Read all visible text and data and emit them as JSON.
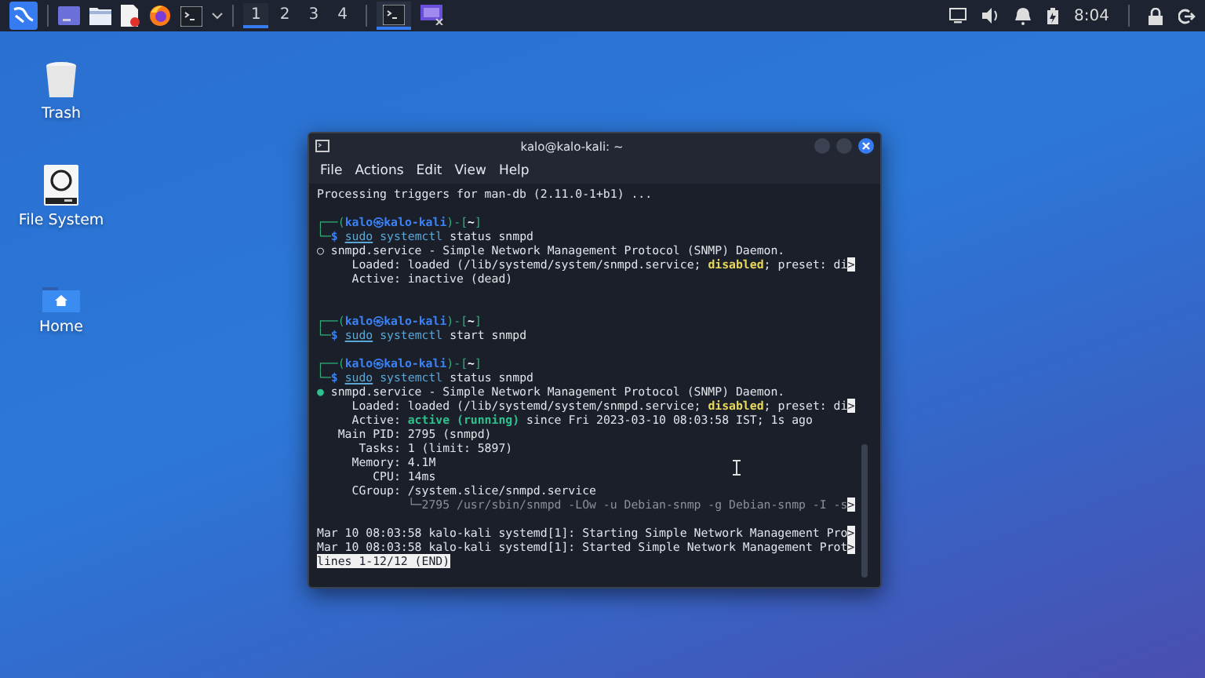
{
  "panel": {
    "launchers": [
      {
        "kind": "desktop"
      },
      {
        "kind": "files"
      },
      {
        "kind": "editor"
      },
      {
        "kind": "browser"
      },
      {
        "kind": "terminal"
      }
    ],
    "workspaces": [
      {
        "label": "1",
        "selected": true
      },
      {
        "label": "2",
        "selected": false
      },
      {
        "label": "3",
        "selected": false
      },
      {
        "label": "4",
        "selected": false
      }
    ],
    "tasks": [
      {
        "kind": "terminal",
        "selected": true
      },
      {
        "kind": "monitor",
        "selected": false
      }
    ],
    "clock": "8:04"
  },
  "desktop": {
    "icons": [
      {
        "label": "Trash",
        "kind": "trash"
      },
      {
        "label": "File System",
        "kind": "drive"
      },
      {
        "label": "Home",
        "kind": "home"
      }
    ]
  },
  "terminal": {
    "title": "kalo@kalo-kali: ~",
    "menu": [
      "File",
      "Actions",
      "Edit",
      "View",
      "Help"
    ],
    "lines": [
      {
        "kind": "text",
        "segs": [
          {
            "kind": "plain",
            "t": "Processing triggers for man-db (2.11.0-1+b1) ..."
          }
        ]
      },
      {
        "kind": "blank"
      },
      {
        "kind": "text",
        "segs": [
          {
            "kind": "frame",
            "t": "┌──("
          },
          {
            "kind": "user",
            "t": "kalo㉿kalo-kali"
          },
          {
            "kind": "frame",
            "t": ")-["
          },
          {
            "kind": "home",
            "t": "~"
          },
          {
            "kind": "frame",
            "t": "]"
          }
        ]
      },
      {
        "kind": "text",
        "segs": [
          {
            "kind": "frame",
            "t": "└─"
          },
          {
            "kind": "dollar",
            "t": "$ "
          },
          {
            "kind": "sudo",
            "t": "sudo"
          },
          {
            "kind": "command",
            "t": " systemctl"
          },
          {
            "kind": "plain",
            "t": " status snmpd"
          }
        ]
      },
      {
        "kind": "text",
        "segs": [
          {
            "kind": "plain",
            "t": "○ snmpd.service - Simple Network Management Protocol (SNMP) Daemon."
          }
        ]
      },
      {
        "kind": "text",
        "segs": [
          {
            "kind": "plain",
            "t": "     Loaded: loaded (/lib/systemd/system/snmpd.service; "
          },
          {
            "kind": "warning",
            "t": "disabled"
          },
          {
            "kind": "plain",
            "t": "; preset: di"
          },
          {
            "kind": "truncated",
            "t": ">"
          }
        ]
      },
      {
        "kind": "text",
        "segs": [
          {
            "kind": "plain",
            "t": "     Active: inactive (dead)"
          }
        ]
      },
      {
        "kind": "blank"
      },
      {
        "kind": "blank"
      },
      {
        "kind": "text",
        "segs": [
          {
            "kind": "frame",
            "t": "┌──("
          },
          {
            "kind": "user",
            "t": "kalo㉿kalo-kali"
          },
          {
            "kind": "frame",
            "t": ")-["
          },
          {
            "kind": "home",
            "t": "~"
          },
          {
            "kind": "frame",
            "t": "]"
          }
        ]
      },
      {
        "kind": "text",
        "segs": [
          {
            "kind": "frame",
            "t": "└─"
          },
          {
            "kind": "dollar",
            "t": "$ "
          },
          {
            "kind": "sudo",
            "t": "sudo"
          },
          {
            "kind": "command",
            "t": " systemctl"
          },
          {
            "kind": "plain",
            "t": " start snmpd"
          }
        ]
      },
      {
        "kind": "blank"
      },
      {
        "kind": "text",
        "segs": [
          {
            "kind": "frame",
            "t": "┌──("
          },
          {
            "kind": "user",
            "t": "kalo㉿kalo-kali"
          },
          {
            "kind": "frame",
            "t": ")-["
          },
          {
            "kind": "home",
            "t": "~"
          },
          {
            "kind": "frame",
            "t": "]"
          }
        ]
      },
      {
        "kind": "text",
        "segs": [
          {
            "kind": "frame",
            "t": "└─"
          },
          {
            "kind": "dollar",
            "t": "$ "
          },
          {
            "kind": "sudo",
            "t": "sudo"
          },
          {
            "kind": "command",
            "t": " systemctl"
          },
          {
            "kind": "plain",
            "t": " status snmpd"
          }
        ]
      },
      {
        "kind": "text",
        "segs": [
          {
            "kind": "success",
            "t": "●"
          },
          {
            "kind": "plain",
            "t": " snmpd.service - Simple Network Management Protocol (SNMP) Daemon."
          }
        ]
      },
      {
        "kind": "text",
        "segs": [
          {
            "kind": "plain",
            "t": "     Loaded: loaded (/lib/systemd/system/snmpd.service; "
          },
          {
            "kind": "warning",
            "t": "disabled"
          },
          {
            "kind": "plain",
            "t": "; preset: di"
          },
          {
            "kind": "truncated",
            "t": ">"
          }
        ]
      },
      {
        "kind": "text",
        "segs": [
          {
            "kind": "plain",
            "t": "     Active: "
          },
          {
            "kind": "success",
            "t": "active (running)"
          },
          {
            "kind": "plain",
            "t": " since Fri 2023-03-10 08:03:58 IST; 1s ago"
          }
        ]
      },
      {
        "kind": "text",
        "segs": [
          {
            "kind": "plain",
            "t": "   Main PID: 2795 (snmpd)"
          }
        ]
      },
      {
        "kind": "text",
        "segs": [
          {
            "kind": "plain",
            "t": "      Tasks: 1 (limit: 5897)"
          }
        ]
      },
      {
        "kind": "text",
        "segs": [
          {
            "kind": "plain",
            "t": "     Memory: 4.1M"
          }
        ]
      },
      {
        "kind": "text",
        "segs": [
          {
            "kind": "plain",
            "t": "        CPU: 14ms"
          }
        ]
      },
      {
        "kind": "text",
        "segs": [
          {
            "kind": "plain",
            "t": "     CGroup: /system.slice/snmpd.service"
          }
        ]
      },
      {
        "kind": "text",
        "segs": [
          {
            "kind": "dim",
            "t": "             └─2795 /usr/sbin/snmpd -LOw -u Debian-snmp -g Debian-snmp -I -s"
          },
          {
            "kind": "truncated",
            "t": ">"
          }
        ]
      },
      {
        "kind": "blank"
      },
      {
        "kind": "text",
        "segs": [
          {
            "kind": "plain",
            "t": "Mar 10 08:03:58 kalo-kali systemd[1]: Starting Simple Network Management Pro"
          },
          {
            "kind": "truncated",
            "t": ">"
          }
        ]
      },
      {
        "kind": "text",
        "segs": [
          {
            "kind": "plain",
            "t": "Mar 10 08:03:58 kalo-kali systemd[1]: Started Simple Network Management Prot"
          },
          {
            "kind": "truncated",
            "t": ">"
          }
        ]
      },
      {
        "kind": "text",
        "segs": [
          {
            "kind": "status",
            "t": "lines 1-12/12 (END)"
          }
        ]
      }
    ]
  }
}
